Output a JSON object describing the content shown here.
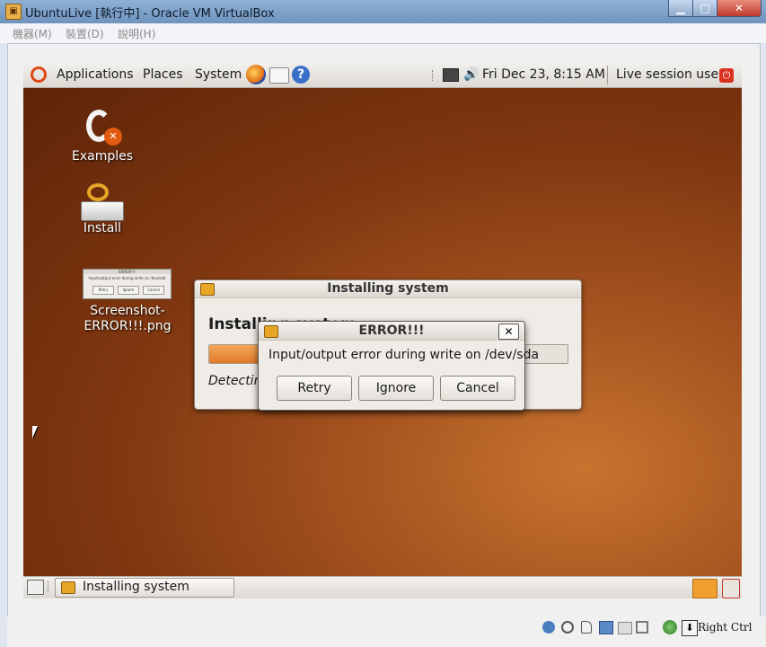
{
  "host": {
    "title": "UbuntuLive [執行中] - Oracle VM VirtualBox",
    "menu": [
      "機器(M)",
      "裝置(D)",
      "說明(H)"
    ],
    "status_hostkey": "Right Ctrl"
  },
  "panel": {
    "applications": "Applications",
    "places": "Places",
    "system": "System",
    "datetime": "Fri Dec 23,  8:15 AM",
    "session_user": "Live session user"
  },
  "desktop": {
    "icons": [
      {
        "label": "Examples"
      },
      {
        "label": "Install"
      },
      {
        "label": "Screenshot-\nERROR!!!.png"
      }
    ]
  },
  "installer": {
    "title": "Installing system",
    "heading": "Installing system",
    "status": "Detecting file systems..."
  },
  "error_dialog": {
    "title": "ERROR!!!",
    "message": "Input/output error during write on /dev/sda",
    "retry": "Retry",
    "ignore": "Ignore",
    "cancel": "Cancel"
  },
  "taskbar": {
    "item": "Installing system"
  },
  "thumbnail": {
    "title": "ERROR!!!",
    "message": "Input/output error during write on /dev/sda",
    "retry": "Retry",
    "ignore": "Ignore",
    "cancel": "Cancel"
  }
}
